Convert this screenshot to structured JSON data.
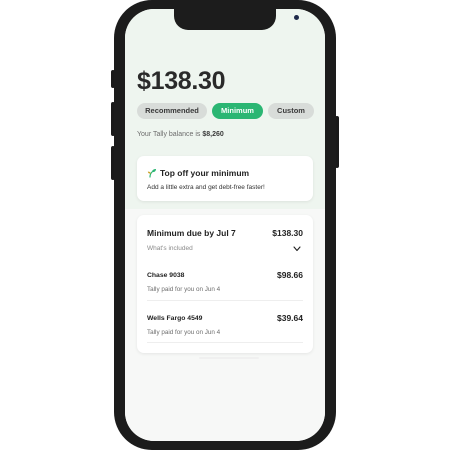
{
  "header": {
    "amount": "$138.30"
  },
  "options": [
    {
      "label": "Recommended",
      "selected": false
    },
    {
      "label": "Minimum",
      "selected": true
    },
    {
      "label": "Custom",
      "selected": false
    }
  ],
  "balance": {
    "prefix": "Your Tally balance is ",
    "value": "$8,260"
  },
  "topoff": {
    "icon": "sprout-icon",
    "title": "Top off your minimum",
    "subtitle": "Add a little extra and get debt-free faster!"
  },
  "minimum": {
    "title": "Minimum due by Jul 7",
    "total": "$138.30",
    "whats_included": "What's included",
    "items": [
      {
        "name": "Chase 9038",
        "amount": "$98.66",
        "note": "Tally paid for you on Jun 4"
      },
      {
        "name": "Wells Fargo 4549",
        "amount": "$39.64",
        "note": "Tally paid for you on Jun 4"
      }
    ]
  },
  "colors": {
    "accent": "#2bb673",
    "background_top": "#eef5ef",
    "frame": "#1c1c1c"
  }
}
